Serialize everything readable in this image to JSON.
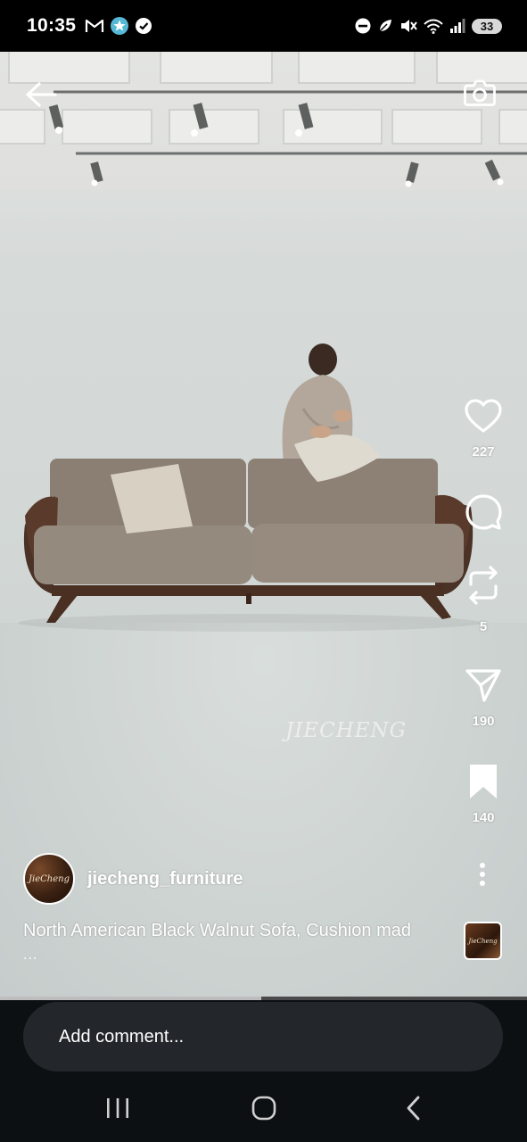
{
  "status_bar": {
    "time": "10:35",
    "battery": "33",
    "left_icons": [
      "gmail-icon",
      "star-badge-icon",
      "check-badge-icon"
    ],
    "right_icons": [
      "do-not-disturb-icon",
      "leaf-icon",
      "mute-icon",
      "wifi-icon",
      "signal-icon"
    ]
  },
  "video": {
    "watermark": "JIECHENG",
    "progress": 0.495
  },
  "top_bar": {
    "back_icon": "arrow-left-icon",
    "camera_icon": "camera-icon"
  },
  "actions": {
    "likes": "227",
    "reposts": "5",
    "shares": "190",
    "saves": "140"
  },
  "post": {
    "username": "jiecheng_furniture",
    "avatar_text": "JieCheng",
    "caption": "North American Black Walnut Sofa, Cushion mad",
    "caption_more": "...",
    "audio_thumb_text": "JieCheng"
  },
  "comment": {
    "placeholder": "Add comment..."
  },
  "colors": {
    "accent_white": "#ffffff",
    "bottom_bg": "#0d1013",
    "input_bg": "#23272b"
  }
}
